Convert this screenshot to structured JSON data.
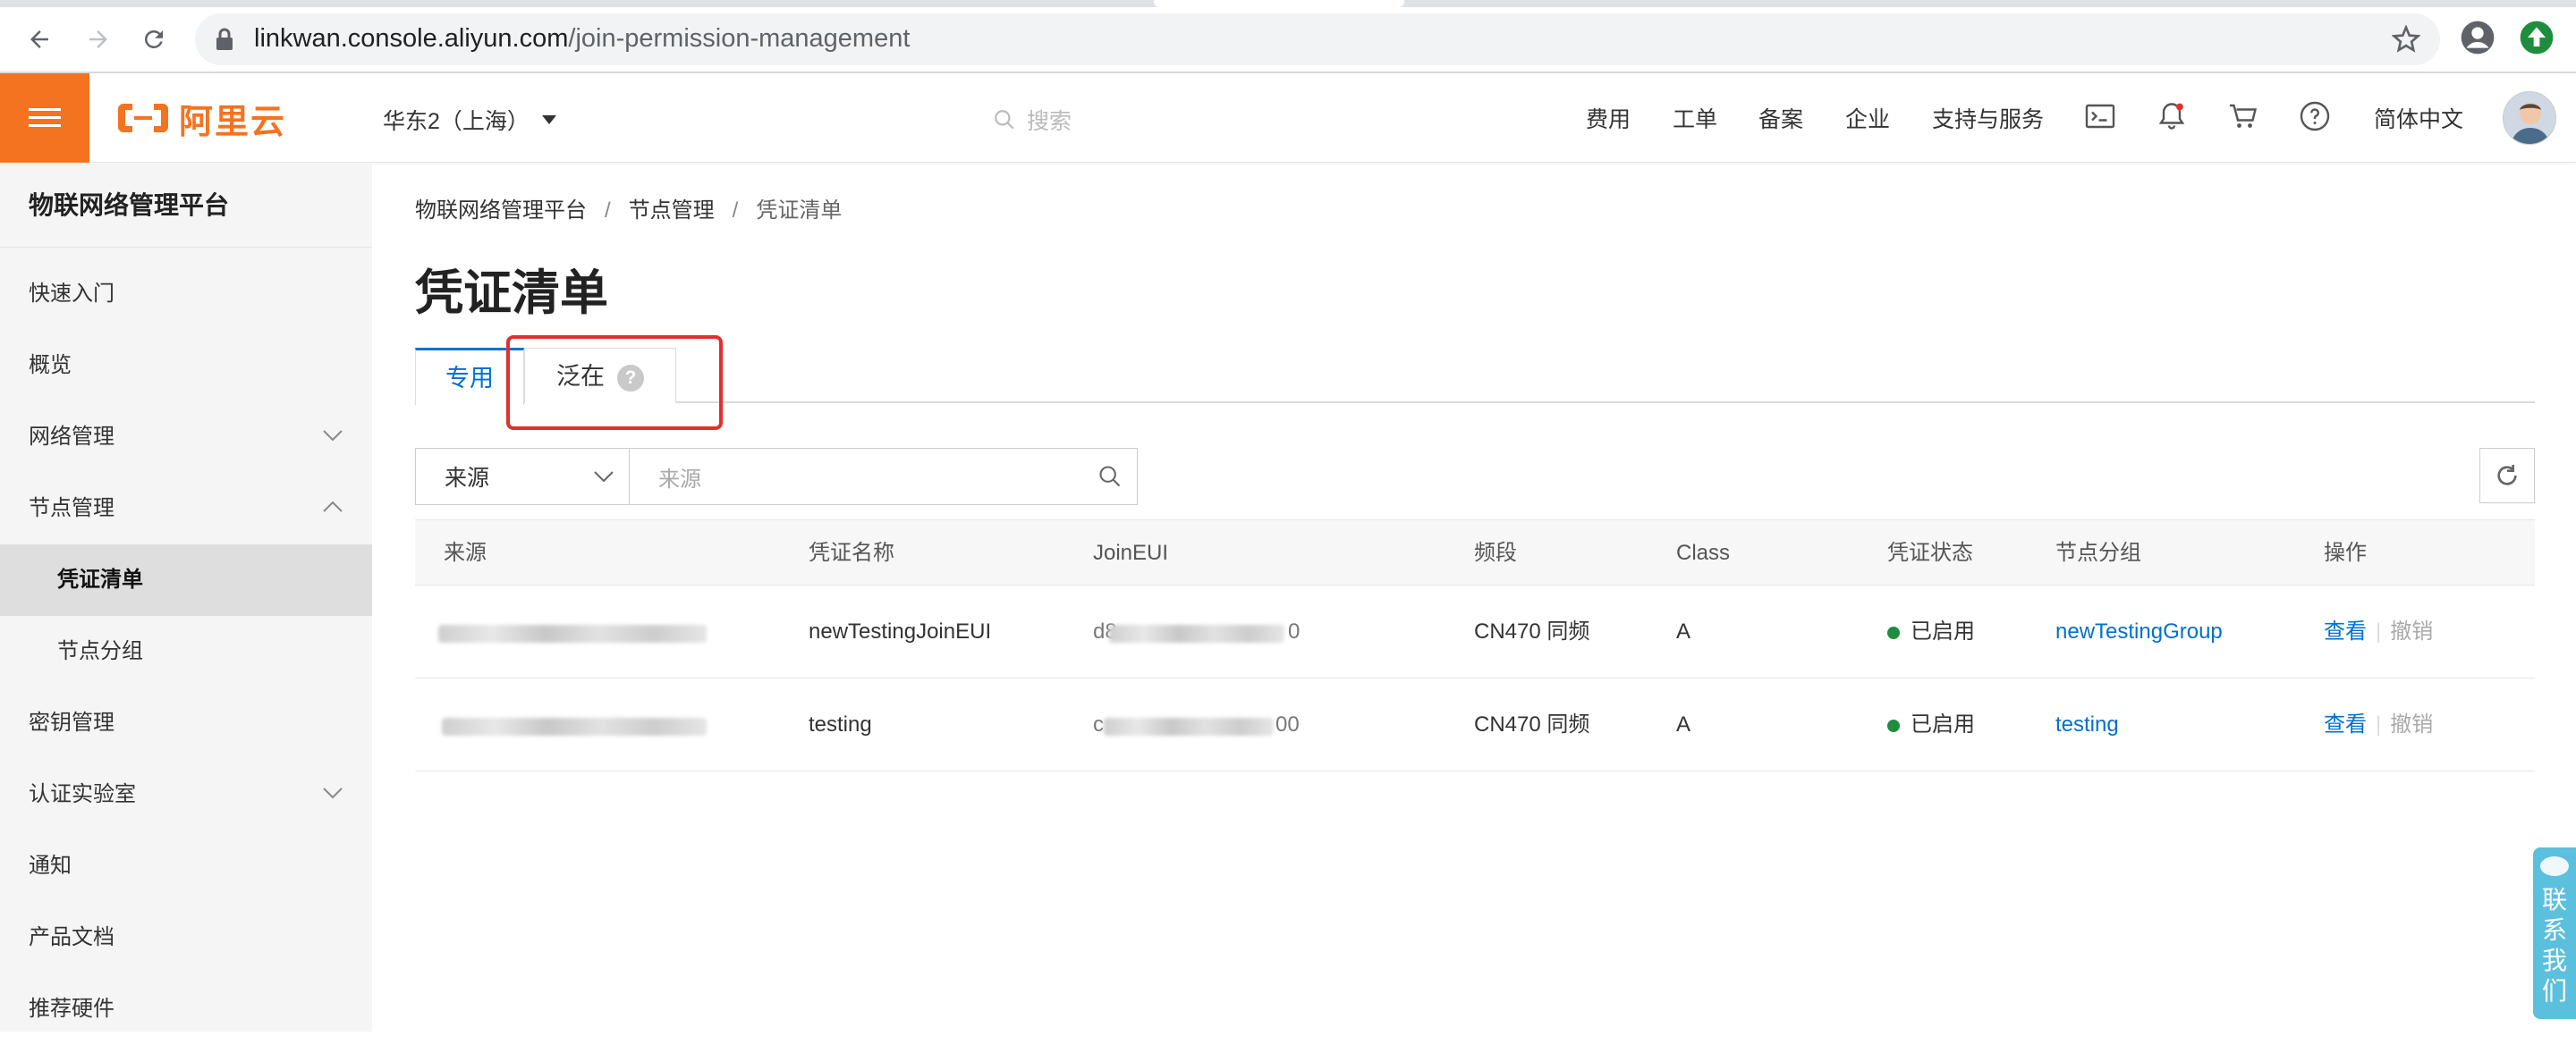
{
  "browser": {
    "url_host": "linkwan.console.aliyun.com",
    "url_path": "/join-permission-management"
  },
  "topbar": {
    "brand": "阿里云",
    "region": "华东2（上海）",
    "search_placeholder": "搜索",
    "nav": [
      "费用",
      "工单",
      "备案",
      "企业",
      "支持与服务"
    ],
    "language": "简体中文"
  },
  "sidebar": {
    "title": "物联网络管理平台",
    "items": [
      {
        "label": "快速入门"
      },
      {
        "label": "概览"
      },
      {
        "label": "网络管理"
      },
      {
        "label": "节点管理"
      },
      {
        "label": "凭证清单"
      },
      {
        "label": "节点分组"
      },
      {
        "label": "密钥管理"
      },
      {
        "label": "认证实验室"
      },
      {
        "label": "通知"
      },
      {
        "label": "产品文档"
      },
      {
        "label": "推荐硬件"
      }
    ]
  },
  "breadcrumb": [
    "物联网络管理平台",
    "节点管理",
    "凭证清单"
  ],
  "page_title": "凭证清单",
  "tabs": [
    {
      "label": "专用",
      "active": true
    },
    {
      "label": "泛在",
      "help": "?"
    }
  ],
  "filter": {
    "select_value": "来源",
    "input_placeholder": "来源"
  },
  "table": {
    "headers": [
      "来源",
      "凭证名称",
      "JoinEUI",
      "频段",
      "Class",
      "凭证状态",
      "节点分组",
      "操作"
    ],
    "rows": [
      {
        "source": "",
        "name": "newTestingJoinEUI",
        "joineui": "d8",
        "joineui_tail": "0",
        "band": "CN470 同频",
        "class": "A",
        "status": "已启用",
        "group": "newTestingGroup",
        "view": "查看",
        "revoke": "撤销"
      },
      {
        "source": "",
        "name": "testing",
        "joineui": "c",
        "joineui_tail": "00",
        "band": "CN470 同频",
        "class": "A",
        "status": "已启用",
        "group": "testing",
        "view": "查看",
        "revoke": "撤销"
      }
    ]
  },
  "contact": [
    "联",
    "系",
    "我",
    "们"
  ],
  "colors": {
    "brand_orange": "#f47321",
    "link_blue": "#0070cc",
    "status_green": "#1e8e3e",
    "highlight_red": "#e0302e",
    "contact_blue": "#5bc0de"
  }
}
